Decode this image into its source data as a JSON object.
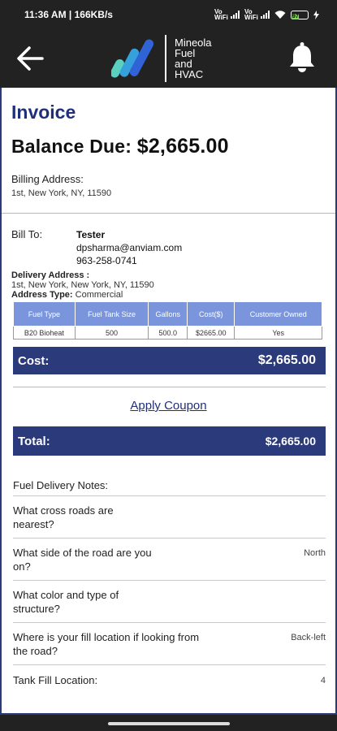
{
  "status_bar": {
    "time_speed": "11:36 AM | 166KB/s",
    "net1": "Vo WiFi",
    "net2": "Vo WiFi",
    "battery": "97"
  },
  "header": {
    "logo_lines": [
      "Mineola",
      "Fuel",
      "and",
      "HVAC"
    ]
  },
  "invoice": {
    "title": "Invoice",
    "balance_label": "Balance Due:",
    "balance_amount": "$2,665.00",
    "billing_address_label": "Billing Address:",
    "billing_address": "1st, New York, NY, 11590",
    "bill_to_label": "Bill To:",
    "bill_to_name": "Tester",
    "bill_to_email": "dpsharma@anviam.com",
    "bill_to_phone": "963-258-0741",
    "delivery_address_label": "Delivery Address :",
    "delivery_address": "1st, New York, New York, NY, 11590",
    "address_type_label": "Address Type:",
    "address_type": "Commercial"
  },
  "table": {
    "headers": [
      "Fuel Type",
      "Fuel Tank Size",
      "Gallons",
      "Cost($)",
      "Customer Owned"
    ],
    "rows": [
      [
        "B20 Bioheat",
        "500",
        "500.0",
        "$2665.00",
        "Yes"
      ]
    ]
  },
  "cost": {
    "label": "Cost:",
    "value": "$2,665.00"
  },
  "coupon": {
    "label": "Apply Coupon"
  },
  "total": {
    "label": "Total:",
    "value": "$2,665.00"
  },
  "notes": [
    {
      "q": "Fuel Delivery Notes:",
      "a": ""
    },
    {
      "q": "What cross roads are nearest?",
      "a": ""
    },
    {
      "q": "What side of the road are you on?",
      "a": "North"
    },
    {
      "q": "What color and type of structure?",
      "a": ""
    },
    {
      "q": "Where is your fill location if looking from the road?",
      "a": "Back-left"
    },
    {
      "q": "Tank Fill Location:",
      "a": "4"
    }
  ]
}
